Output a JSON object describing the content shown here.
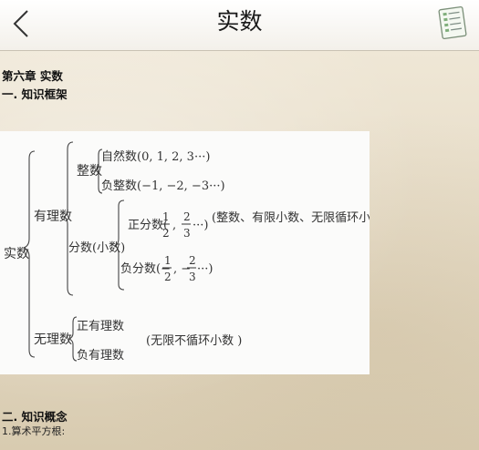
{
  "header": {
    "title": "实数",
    "back_icon": "chevron-left-icon",
    "doc_icon": "document-list-icon"
  },
  "content": {
    "chapter": "第六章  实数",
    "section1": "一.    知识框架",
    "section2": "二.  知识概念",
    "item1": "1.算术平方根:"
  },
  "diagram": {
    "root": "实数",
    "rational": "有理数",
    "integer": "整数",
    "natural": "自然数(0,  1,  2,  3···)",
    "neg_integer": "负整数(−1,  −2,  −3···)",
    "fraction": "分数(小数)",
    "pos_fraction": "正分数(",
    "neg_fraction": "负分数(−",
    "frac_half_num": "1",
    "frac_half_den": "2",
    "frac_third_num": "2",
    "frac_third_den": "3",
    "dots": "···)",
    "note_rational": "(整数、有限小数、无限循环小数)",
    "irrational": "无理数",
    "pos_irrational": "正有理数",
    "neg_irrational": "负有理数",
    "note_irrational": "(无限不循环小数    )"
  }
}
